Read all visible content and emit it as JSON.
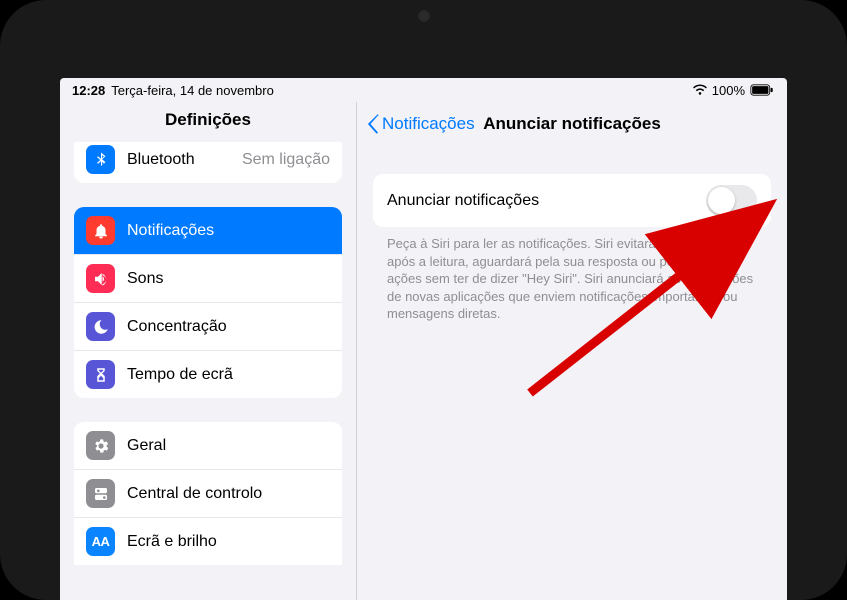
{
  "status": {
    "time": "12:28",
    "date": "Terça-feira, 14 de novembro",
    "battery_pct": "100%"
  },
  "sidebar": {
    "title": "Definições",
    "group1": {
      "bluetooth": {
        "label": "Bluetooth",
        "value": "Sem ligação"
      }
    },
    "group2": {
      "notifications": {
        "label": "Notificações"
      },
      "sounds": {
        "label": "Sons"
      },
      "focus": {
        "label": "Concentração"
      },
      "screentime": {
        "label": "Tempo de ecrã"
      }
    },
    "group3": {
      "general": {
        "label": "Geral"
      },
      "control": {
        "label": "Central de controlo"
      },
      "display": {
        "label": "Ecrã e brilho"
      }
    }
  },
  "detail": {
    "back_label": "Notificações",
    "title": "Anunciar notificações",
    "switch_label": "Anunciar notificações",
    "footer": "Peça à Siri para ler as notificações. Siri evitará interromper e, após a leitura, aguardará pela sua resposta ou pelas suas ações sem ter de dizer \"Hey Siri\". Siri anunciará as notificações de novas aplicações que enviem notificações importantes ou mensagens diretas."
  }
}
